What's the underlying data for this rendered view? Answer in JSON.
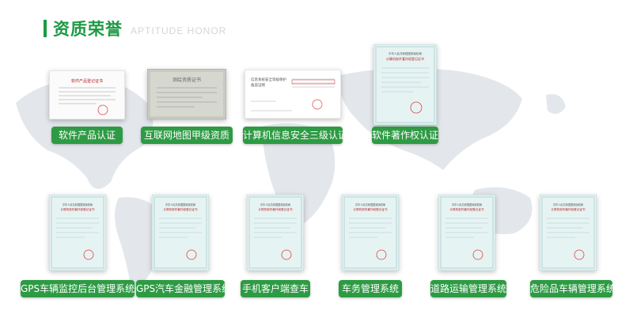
{
  "header": {
    "title": "资质荣誉",
    "subtitle": "APTITUDE HONOR"
  },
  "colors": {
    "accent": "#1c9a43",
    "label_bg": "#2e9b44",
    "map": "#e2e6ea"
  },
  "certificates_top": [
    {
      "label": "软件产品认证",
      "style": "white-doc"
    },
    {
      "label": "互联网地图甲级资质",
      "style": "grey-doc"
    },
    {
      "label": "计算机信息安全三级认证",
      "style": "white-doc"
    },
    {
      "label": "软件著作权认证",
      "style": "blue-doc"
    }
  ],
  "certificates_bottom": [
    {
      "label": "GPS车辆监控后台管理系统",
      "style": "blue-doc"
    },
    {
      "label": "GPS汽车金融管理系统",
      "style": "blue-doc"
    },
    {
      "label": "手机客户端查车",
      "style": "blue-doc"
    },
    {
      "label": "车务管理系统",
      "style": "blue-doc"
    },
    {
      "label": "道路运输管理系统",
      "style": "blue-doc"
    },
    {
      "label": "危险品车辆管理系统",
      "style": "blue-doc"
    }
  ]
}
